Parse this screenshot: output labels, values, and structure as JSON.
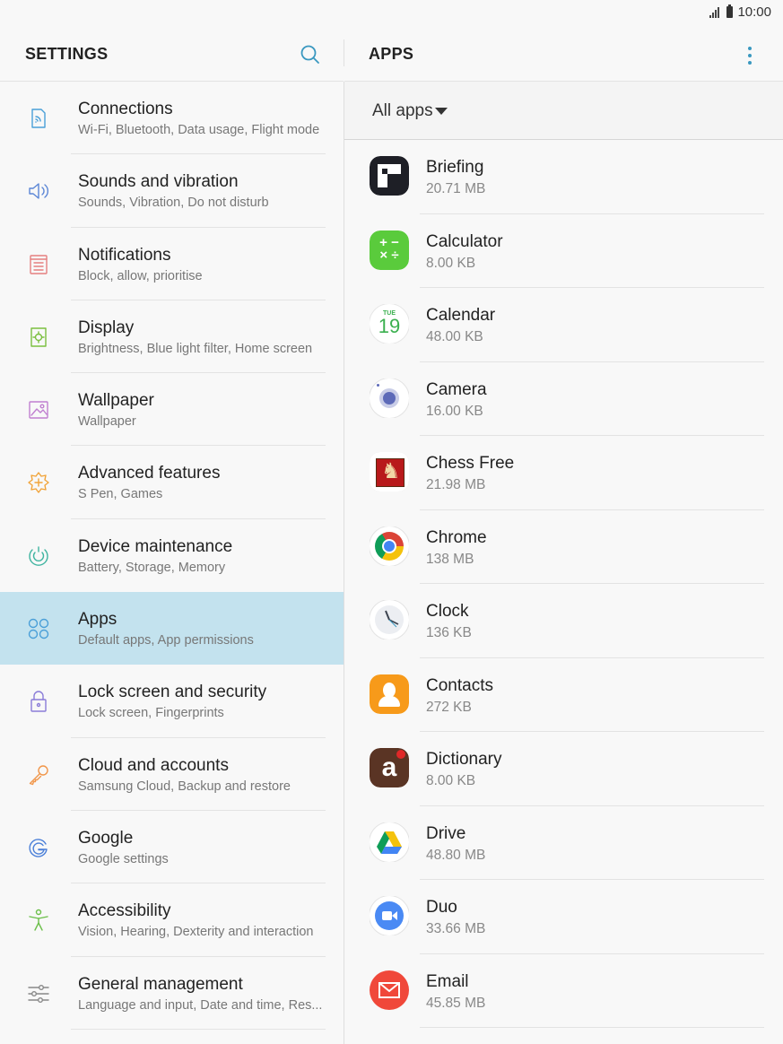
{
  "status_bar": {
    "time": "10:00"
  },
  "left_pane": {
    "title": "SETTINGS",
    "items": [
      {
        "title": "Connections",
        "subtitle": "Wi-Fi, Bluetooth, Data usage, Flight mode",
        "icon": "connections-icon",
        "color": "#4a9fd8"
      },
      {
        "title": "Sounds and vibration",
        "subtitle": "Sounds, Vibration, Do not disturb",
        "icon": "volume-icon",
        "color": "#5b86d6"
      },
      {
        "title": "Notifications",
        "subtitle": "Block, allow, prioritise",
        "icon": "notifications-icon",
        "color": "#e57f7f"
      },
      {
        "title": "Display",
        "subtitle": "Brightness, Blue light filter, Home screen",
        "icon": "display-icon",
        "color": "#7bbf3f"
      },
      {
        "title": "Wallpaper",
        "subtitle": "Wallpaper",
        "icon": "wallpaper-icon",
        "color": "#c07fd0"
      },
      {
        "title": "Advanced features",
        "subtitle": "S Pen, Games",
        "icon": "advanced-features-icon",
        "color": "#f1a43a"
      },
      {
        "title": "Device maintenance",
        "subtitle": "Battery, Storage, Memory",
        "icon": "device-maintenance-icon",
        "color": "#3fb4a0"
      },
      {
        "title": "Apps",
        "subtitle": "Default apps, App permissions",
        "icon": "apps-icon",
        "color": "#4a9fd8",
        "selected": true
      },
      {
        "title": "Lock screen and security",
        "subtitle": "Lock screen, Fingerprints",
        "icon": "lock-icon",
        "color": "#8a7cd8"
      },
      {
        "title": "Cloud and accounts",
        "subtitle": "Samsung Cloud, Backup and restore",
        "icon": "key-icon",
        "color": "#f1964a"
      },
      {
        "title": "Google",
        "subtitle": "Google settings",
        "icon": "google-icon",
        "color": "#4a7fd8"
      },
      {
        "title": "Accessibility",
        "subtitle": "Vision, Hearing, Dexterity and interaction",
        "icon": "accessibility-icon",
        "color": "#6cbf4a"
      },
      {
        "title": "General management",
        "subtitle": "Language and input, Date and time, Res...",
        "icon": "sliders-icon",
        "color": "#888888"
      }
    ]
  },
  "right_pane": {
    "title": "APPS",
    "filter": "All apps",
    "apps": [
      {
        "name": "Briefing",
        "size": "20.71 MB",
        "icon": "briefing-icon"
      },
      {
        "name": "Calculator",
        "size": "8.00 KB",
        "icon": "calculator-icon"
      },
      {
        "name": "Calendar",
        "size": "48.00 KB",
        "icon": "calendar-icon",
        "date_text": "TUE",
        "date_num": "19"
      },
      {
        "name": "Camera",
        "size": "16.00 KB",
        "icon": "camera-icon"
      },
      {
        "name": "Chess Free",
        "size": "21.98 MB",
        "icon": "chess-icon"
      },
      {
        "name": "Chrome",
        "size": "138 MB",
        "icon": "chrome-icon"
      },
      {
        "name": "Clock",
        "size": "136 KB",
        "icon": "clock-icon"
      },
      {
        "name": "Contacts",
        "size": "272 KB",
        "icon": "contacts-icon"
      },
      {
        "name": "Dictionary",
        "size": "8.00 KB",
        "icon": "dictionary-icon"
      },
      {
        "name": "Drive",
        "size": "48.80 MB",
        "icon": "drive-icon"
      },
      {
        "name": "Duo",
        "size": "33.66 MB",
        "icon": "duo-icon"
      },
      {
        "name": "Email",
        "size": "45.85 MB",
        "icon": "email-icon"
      }
    ]
  }
}
